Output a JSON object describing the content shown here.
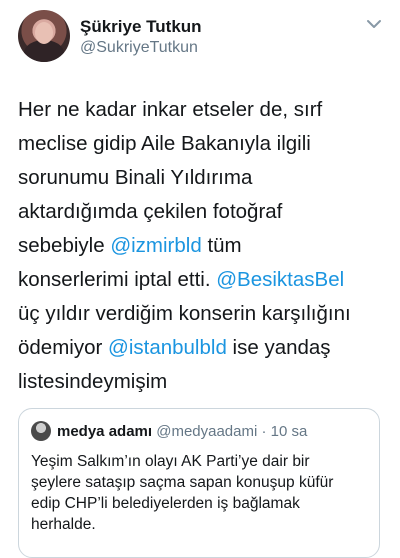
{
  "author": {
    "display_name": "Şükriye Tutkun",
    "handle": "@SukriyeTutkun"
  },
  "tweet": {
    "line1": "Her ne kadar inkar etseler de, sırf",
    "line2": "meclise gidip Aile Bakanıyla ilgili",
    "line3": "sorunumu Binali Yıldırıma",
    "line4": "aktardığımda çekilen fotoğraf",
    "line5_a": "sebebiyle ",
    "mention1": "@izmirbld",
    "line5_b": " tüm",
    "line6_a": "konserlerimi iptal etti. ",
    "mention2": "@BesiktasBel",
    "line7": "üç yıldır verdiğim konserin karşılığını",
    "line8_a": "ödemiyor ",
    "mention3": "@istanbulbld",
    "line8_b": " ise yandaş",
    "line9": "listesindeymişim"
  },
  "quote": {
    "name": "medya adamı",
    "handle": "@medyaadami",
    "separator": "·",
    "time": "10 sa",
    "line1": "Yeşim Salkım’ın olayı AK Parti’ye dair bir",
    "line2": "şeylere sataşıp saçma sapan konuşup küfür",
    "line3": "edip CHP’li belediyelerden iş bağlamak",
    "line4": "herhalde."
  },
  "icons": {
    "menu": "chevron-down-icon"
  },
  "colors": {
    "link": "#1b95e0",
    "secondary_text": "#657786",
    "border": "#ccd6dd"
  }
}
